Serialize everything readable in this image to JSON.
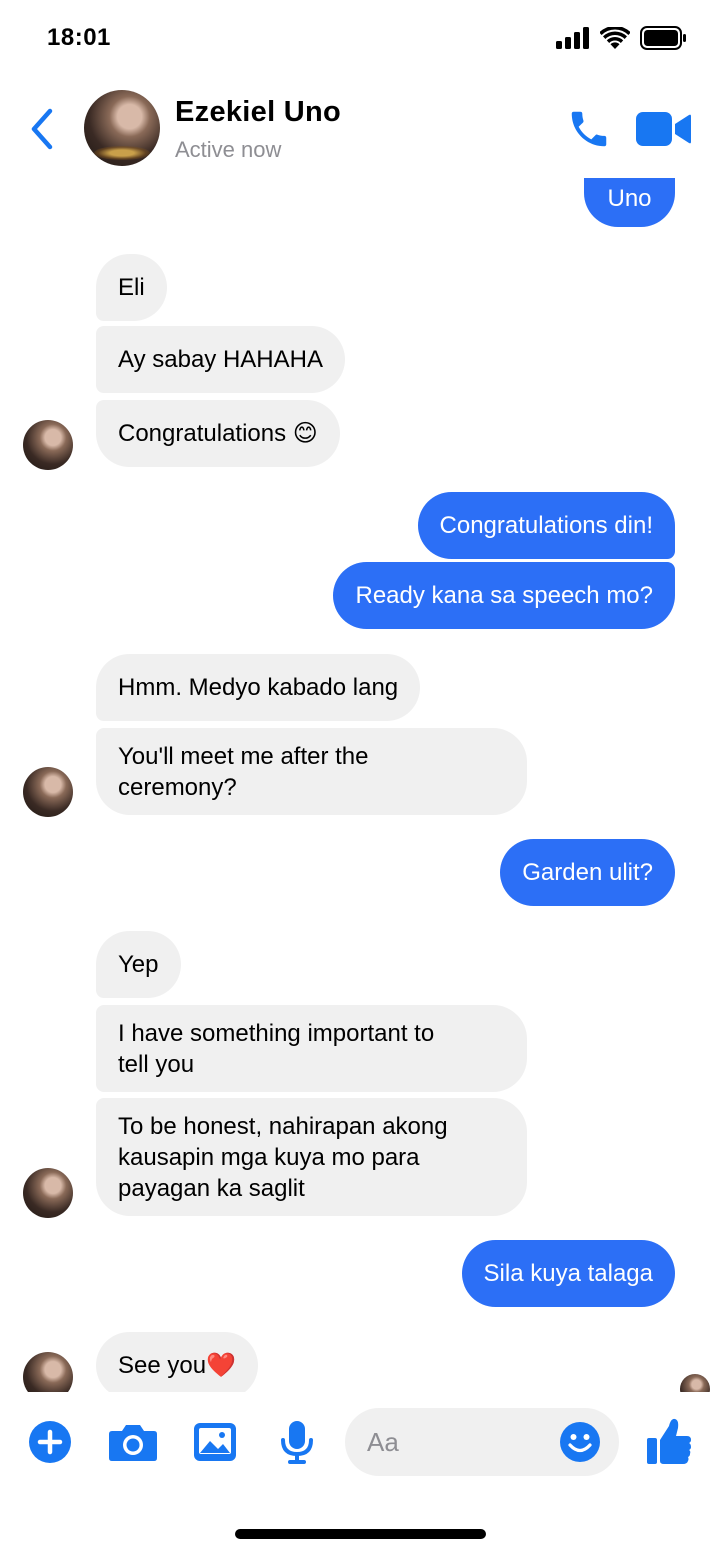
{
  "status_bar": {
    "time": "18:01"
  },
  "header": {
    "contact_name": "Ezekiel Uno",
    "contact_status": "Active now"
  },
  "messages": [
    {
      "from": "me",
      "text": "Uno"
    },
    {
      "from": "contact",
      "text": "Eli"
    },
    {
      "from": "contact",
      "text": "Ay sabay HAHAHA"
    },
    {
      "from": "contact",
      "text": "Congratulations 😊"
    },
    {
      "from": "me",
      "text": "Congratulations din!"
    },
    {
      "from": "me",
      "text": "Ready kana sa speech mo?"
    },
    {
      "from": "contact",
      "text": "Hmm. Medyo kabado lang"
    },
    {
      "from": "contact",
      "text": "You'll meet me after the\nceremony?"
    },
    {
      "from": "me",
      "text": "Garden ulit?"
    },
    {
      "from": "contact",
      "text": "Yep"
    },
    {
      "from": "contact",
      "text": "I have something important to\ntell you"
    },
    {
      "from": "contact",
      "text": "To be honest, nahirapan akong\nkausapin mga kuya mo para\npayagan ka saglit"
    },
    {
      "from": "me",
      "text": "Sila kuya talaga"
    },
    {
      "from": "contact",
      "text": "See you❤️"
    }
  ],
  "composer": {
    "placeholder": "Aa",
    "icons": [
      "plus-circle-icon",
      "camera-icon",
      "photo-icon",
      "microphone-icon",
      "emoji-icon",
      "thumbs-up-icon"
    ]
  },
  "colors": {
    "accent": "#1877f2",
    "sent_bubble": "#2c6ff6",
    "received_bubble": "#f0f0f0",
    "secondary_text": "#8e8e93"
  }
}
